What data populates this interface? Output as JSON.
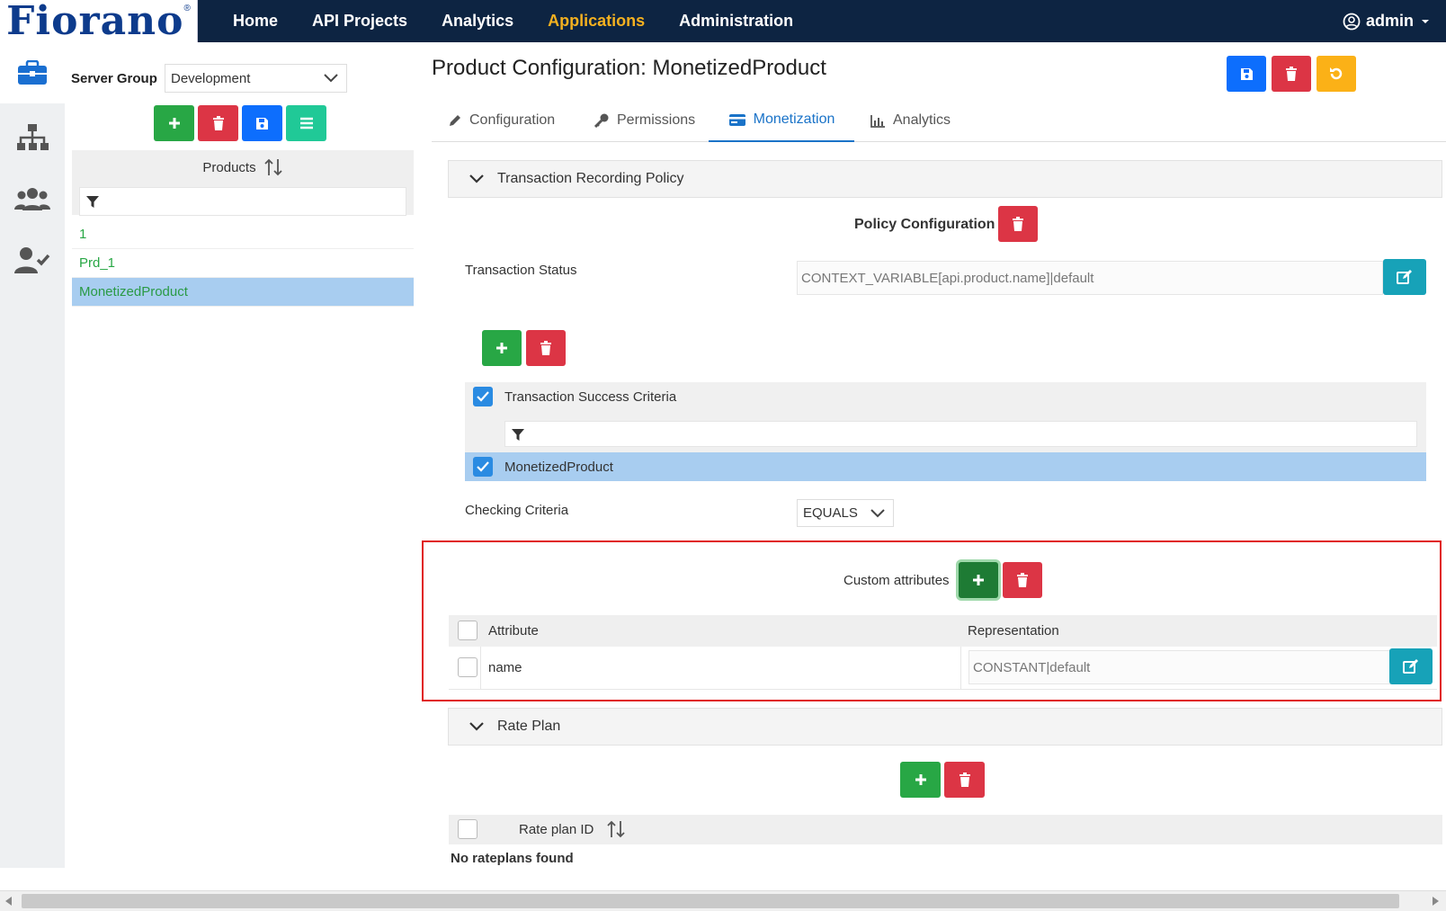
{
  "app": {
    "logo": "Fiorano",
    "logo_mark": "®"
  },
  "nav": {
    "items": [
      {
        "label": "Home",
        "active": false
      },
      {
        "label": "API Projects",
        "active": false
      },
      {
        "label": "Analytics",
        "active": false
      },
      {
        "label": "Applications",
        "active": true
      },
      {
        "label": "Administration",
        "active": false
      }
    ],
    "user": "admin"
  },
  "rail": {
    "icons": [
      "briefcase-icon",
      "sitemap-icon",
      "users-icon",
      "user-check-icon"
    ]
  },
  "products_panel": {
    "server_group_label": "Server Group",
    "server_group_value": "Development",
    "header": "Products",
    "filter_value": "",
    "items": [
      {
        "label": "1",
        "selected": false
      },
      {
        "label": "Prd_1",
        "selected": false
      },
      {
        "label": "MonetizedProduct",
        "selected": true
      }
    ]
  },
  "main": {
    "title": "Product Configuration: MonetizedProduct",
    "tabs": [
      {
        "label": "Configuration",
        "active": false
      },
      {
        "label": "Permissions",
        "active": false
      },
      {
        "label": "Monetization",
        "active": true
      },
      {
        "label": "Analytics",
        "active": false
      }
    ],
    "transaction_section": {
      "title": "Transaction Recording Policy",
      "policy_config_label": "Policy Configuration",
      "status_label": "Transaction Status",
      "status_value": "CONTEXT_VARIABLE[api.product.name]|default",
      "criteria_header": "Transaction Success Criteria",
      "criteria_filter": "",
      "criteria_row": "MonetizedProduct",
      "checking_label": "Checking Criteria",
      "checking_value": "EQUALS"
    },
    "custom_attributes": {
      "label": "Custom attributes",
      "col_attribute": "Attribute",
      "col_representation": "Representation",
      "rows": [
        {
          "attribute": "name",
          "representation": "CONSTANT|default"
        }
      ]
    },
    "rate_plan": {
      "title": "Rate Plan",
      "col_id": "Rate plan ID",
      "empty": "No rateplans found"
    }
  },
  "colors": {
    "nav_bg": "#0d2442",
    "active_nav": "#f4b120",
    "success": "#28a745",
    "danger": "#dc3545",
    "primary": "#0d6efd",
    "selected_row": "#a8cdf0"
  }
}
